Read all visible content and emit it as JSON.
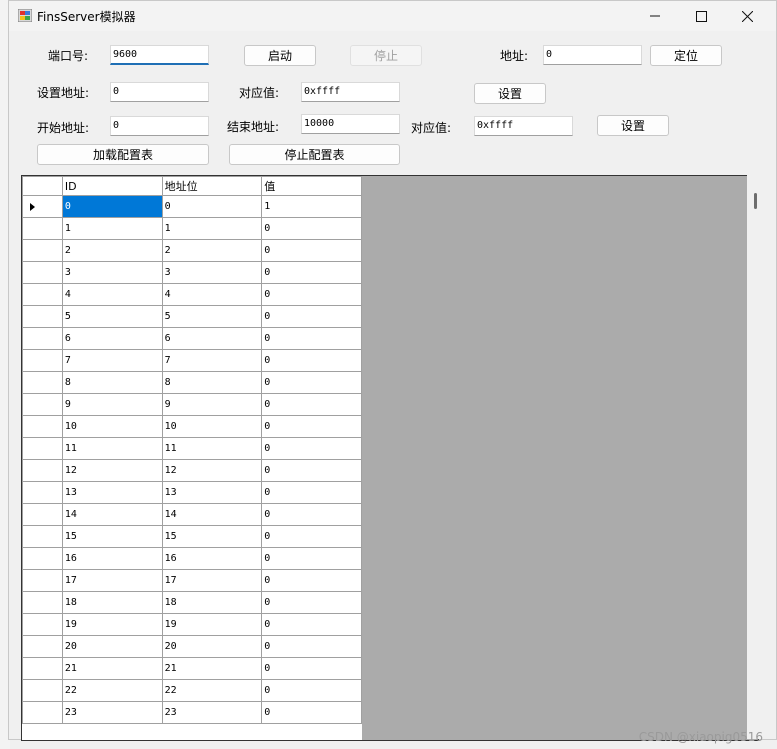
{
  "window": {
    "title": "FinsServer模拟器"
  },
  "controls": {
    "port_label": "端口号:",
    "port_value": "9600",
    "start_label": "启动",
    "stop_label": "停止",
    "addr_label": "地址:",
    "addr_value": "0",
    "locate_label": "定位",
    "set_addr_label": "设置地址:",
    "set_addr_value": "0",
    "corr_value_label": "对应值:",
    "corr_value": "0xffff",
    "set_label": "设置",
    "start_addr_label": "开始地址:",
    "start_addr_value": "0",
    "end_addr_label": "结束地址:",
    "end_addr_value": "10000",
    "corr_value2_label": "对应值:",
    "corr_value2": "0xffff",
    "set2_label": "设置",
    "load_config_label": "加载配置表",
    "stop_config_label": "停止配置表"
  },
  "grid": {
    "headers": [
      "ID",
      "地址位",
      "值"
    ],
    "rows": [
      [
        "0",
        "0",
        "1"
      ],
      [
        "1",
        "1",
        "0"
      ],
      [
        "2",
        "2",
        "0"
      ],
      [
        "3",
        "3",
        "0"
      ],
      [
        "4",
        "4",
        "0"
      ],
      [
        "5",
        "5",
        "0"
      ],
      [
        "6",
        "6",
        "0"
      ],
      [
        "7",
        "7",
        "0"
      ],
      [
        "8",
        "8",
        "0"
      ],
      [
        "9",
        "9",
        "0"
      ],
      [
        "10",
        "10",
        "0"
      ],
      [
        "11",
        "11",
        "0"
      ],
      [
        "12",
        "12",
        "0"
      ],
      [
        "13",
        "13",
        "0"
      ],
      [
        "14",
        "14",
        "0"
      ],
      [
        "15",
        "15",
        "0"
      ],
      [
        "16",
        "16",
        "0"
      ],
      [
        "17",
        "17",
        "0"
      ],
      [
        "18",
        "18",
        "0"
      ],
      [
        "19",
        "19",
        "0"
      ],
      [
        "20",
        "20",
        "0"
      ],
      [
        "21",
        "21",
        "0"
      ],
      [
        "22",
        "22",
        "0"
      ],
      [
        "23",
        "23",
        "0"
      ]
    ]
  },
  "watermark": "CSDN @xiaopig0516"
}
